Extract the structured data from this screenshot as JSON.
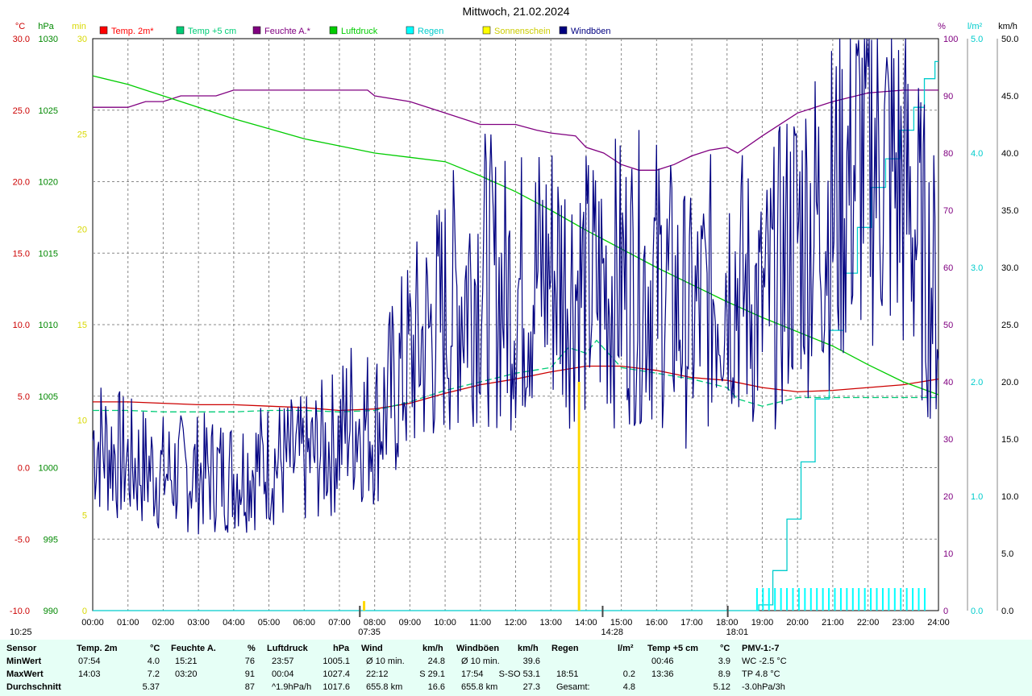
{
  "chart_data": {
    "type": "line",
    "title": "Mittwoch, 21.02.2024",
    "x_ticks": [
      "00:00",
      "01:00",
      "02:00",
      "03:00",
      "04:00",
      "05:00",
      "06:00",
      "07:00",
      "08:00",
      "09:00",
      "10:00",
      "11:00",
      "12:00",
      "13:00",
      "14:00",
      "15:00",
      "16:00",
      "17:00",
      "18:00",
      "19:00",
      "20:00",
      "21:00",
      "22:00",
      "23:00",
      "24:00"
    ],
    "axes": {
      "temp": {
        "unit": "°C",
        "color": "#cc0000",
        "range": [
          -10,
          30
        ],
        "ticks": [
          "30.0",
          "25.0",
          "20.0",
          "15.0",
          "10.0",
          "5.0",
          "0.0",
          "-5.0",
          "-10.0"
        ]
      },
      "pressure": {
        "unit": "hPa",
        "color": "#008800",
        "range": [
          990,
          1030
        ],
        "ticks": [
          "1030",
          "1025",
          "1020",
          "1015",
          "1010",
          "1005",
          "1000",
          "995",
          "990"
        ]
      },
      "sun": {
        "unit": "min",
        "color": "#d8d800",
        "range": [
          0,
          30
        ],
        "ticks": [
          "30",
          "25",
          "20",
          "15",
          "10",
          "5",
          "0"
        ]
      },
      "humidity": {
        "unit": "%",
        "color": "#800080",
        "range": [
          0,
          100
        ],
        "ticks": [
          "100",
          "90",
          "80",
          "70",
          "60",
          "50",
          "40",
          "30",
          "20",
          "10",
          "0"
        ]
      },
      "rain": {
        "unit": "l/m²",
        "color": "#00cccc",
        "range": [
          0,
          5
        ],
        "ticks": [
          "5.0",
          "4.0",
          "3.0",
          "2.0",
          "1.0",
          "0.0"
        ]
      },
      "wind": {
        "unit": "km/h",
        "color": "#000000",
        "range": [
          0,
          50
        ],
        "ticks": [
          "50.0",
          "45.0",
          "40.0",
          "35.0",
          "30.0",
          "25.0",
          "20.0",
          "15.0",
          "10.0",
          "5.0",
          "0.0"
        ]
      }
    },
    "legend": [
      {
        "label": "Temp. 2m*",
        "color": "#ff0000"
      },
      {
        "label": "Temp +5 cm",
        "color": "#00cc77"
      },
      {
        "label": "Feuchte A.*",
        "color": "#800080"
      },
      {
        "label": "Luftdruck",
        "color": "#00cc00"
      },
      {
        "label": "Regen",
        "color": "#00ffff"
      },
      {
        "label": "Sonnenschein",
        "color": "#ffff00"
      },
      {
        "label": "Windböen",
        "color": "#000080"
      }
    ],
    "series": [
      {
        "name": "Temp. 2m*",
        "axis": "temp",
        "color": "#cc0000",
        "x": [
          0,
          1,
          2,
          3,
          4,
          5,
          6,
          7,
          8,
          9,
          10,
          11,
          12,
          13,
          14,
          15,
          16,
          17,
          18,
          19,
          20,
          21,
          22,
          23,
          24
        ],
        "y": [
          4.6,
          4.6,
          4.5,
          4.4,
          4.4,
          4.3,
          4.2,
          4.0,
          4.1,
          4.5,
          5.2,
          5.8,
          6.2,
          6.7,
          7.1,
          7.1,
          6.8,
          6.3,
          6.1,
          5.6,
          5.3,
          5.4,
          5.6,
          5.8,
          6.2
        ]
      },
      {
        "name": "Temp +5 cm",
        "axis": "temp",
        "color": "#00cc77",
        "dashed": true,
        "x": [
          0,
          1,
          2,
          3,
          4,
          5,
          6,
          7,
          8,
          9,
          10,
          11,
          11.5,
          12,
          13,
          13.5,
          14,
          14.3,
          15,
          16,
          17,
          18,
          18.3,
          19,
          20,
          21,
          22,
          23,
          24
        ],
        "y": [
          4.0,
          4.0,
          3.9,
          3.9,
          3.9,
          4.0,
          4.0,
          3.9,
          4.0,
          4.6,
          5.4,
          6.0,
          6.3,
          6.6,
          7.0,
          8.4,
          8.0,
          8.9,
          7.0,
          6.6,
          6.2,
          5.6,
          4.8,
          4.3,
          4.9,
          4.9,
          4.9,
          4.9,
          4.9
        ]
      },
      {
        "name": "Feuchte A.*",
        "axis": "humidity",
        "color": "#800080",
        "x": [
          0,
          0.6,
          1,
          1.5,
          2,
          2.5,
          3,
          3.5,
          4,
          5,
          6,
          7,
          7.8,
          8,
          9,
          10,
          11,
          12,
          12.6,
          13,
          13.7,
          14,
          14.5,
          15,
          15.5,
          16,
          16.5,
          17,
          17.5,
          18,
          18.3,
          19,
          20,
          21,
          22,
          23,
          24
        ],
        "y": [
          88,
          88,
          88,
          89,
          89,
          90,
          90,
          90,
          91,
          91,
          91,
          91,
          91,
          90,
          89,
          87,
          85,
          85,
          84,
          83.5,
          83,
          81,
          80,
          78,
          77,
          77,
          78,
          79.5,
          80.5,
          81,
          80,
          83,
          87,
          89,
          90.5,
          91,
          91
        ]
      },
      {
        "name": "Luftdruck",
        "axis": "pressure",
        "color": "#00cc00",
        "x": [
          0,
          1,
          2,
          3,
          4,
          5,
          6,
          7,
          8,
          9,
          10,
          11,
          12,
          13,
          14,
          15,
          16,
          17,
          18,
          19,
          20,
          21,
          22,
          23,
          24
        ],
        "y": [
          1027.4,
          1026.8,
          1026.0,
          1025.2,
          1024.4,
          1023.7,
          1023.0,
          1022.5,
          1022.0,
          1021.7,
          1021.4,
          1020.4,
          1019.3,
          1018.0,
          1016.6,
          1015.3,
          1014.0,
          1012.8,
          1011.6,
          1010.5,
          1009.5,
          1008.5,
          1007.2,
          1006.0,
          1005.1
        ]
      },
      {
        "name": "Regen",
        "axis": "rain",
        "color": "#00cccc",
        "x": [
          0,
          18.7,
          18.9,
          19.3,
          19.7,
          20.1,
          20.5,
          20.9,
          21.3,
          21.7,
          22.1,
          22.5,
          22.9,
          23.3,
          23.6,
          23.9,
          24
        ],
        "y": [
          0,
          0,
          0.05,
          0.35,
          0.8,
          1.3,
          1.85,
          2.45,
          2.95,
          3.35,
          3.7,
          3.95,
          4.2,
          4.4,
          4.65,
          4.8,
          4.8
        ]
      },
      {
        "name": "Windböen",
        "axis": "wind",
        "color": "#000080",
        "noisy": true,
        "x": [
          0,
          1,
          2,
          3,
          4,
          5,
          6,
          7,
          7.3,
          8,
          9,
          10,
          11,
          11.5,
          12,
          13,
          14,
          15,
          16,
          17,
          18,
          19,
          20,
          21,
          22,
          23,
          24
        ],
        "y": [
          15,
          13,
          12,
          12,
          12,
          13,
          13,
          15,
          17,
          16,
          22,
          26,
          30,
          28,
          28,
          30,
          28,
          29,
          29,
          25,
          30,
          26,
          33,
          35,
          41,
          37,
          27
        ]
      }
    ],
    "sunshine_bars": [
      {
        "x": 13.8,
        "y": 12
      },
      {
        "x": 7.7,
        "y": 0.5
      }
    ],
    "markers": [
      {
        "label": "07:35",
        "x": 7.58
      },
      {
        "label": "14:28",
        "x": 14.47
      },
      {
        "label": "18:01",
        "x": 18.02
      }
    ],
    "corner_time": "10:25"
  },
  "stats": {
    "headers": [
      "Sensor",
      "Temp. 2m",
      "°C",
      "Feuchte A.",
      "%",
      "Luftdruck",
      "hPa",
      "Wind",
      "km/h",
      "Windböen",
      "km/h",
      "Regen",
      "l/m²",
      "Temp +5 cm",
      "°C",
      "PMV-1:-7"
    ],
    "rows": [
      {
        "label": "MinWert",
        "cells": [
          "07:54",
          "4.0",
          "15:21",
          "76",
          "23:57",
          "1005.1",
          "Ø 10 min.",
          "24.8",
          "Ø 10 min.",
          "39.6",
          "",
          "",
          "00:46",
          "3.9",
          "WC -2.5 °C"
        ]
      },
      {
        "label": "MaxWert",
        "cells": [
          "14:03",
          "7.2",
          "03:20",
          "91",
          "00:04",
          "1027.4",
          "22:12",
          "S 29.1",
          "17:54",
          "S-SO 53.1",
          "18:51",
          "0.2",
          "13:36",
          "8.9",
          "TP 4.8 °C"
        ]
      },
      {
        "label": "Durchschnitt",
        "cells": [
          "",
          "5.37",
          "",
          "87",
          "^1.9hPa/h",
          "1017.6",
          "655.8 km",
          "16.6",
          "655.8 km",
          "27.3",
          "Gesamt:",
          "4.8",
          "",
          "5.12",
          "-3.0hPa/3h"
        ]
      }
    ]
  }
}
